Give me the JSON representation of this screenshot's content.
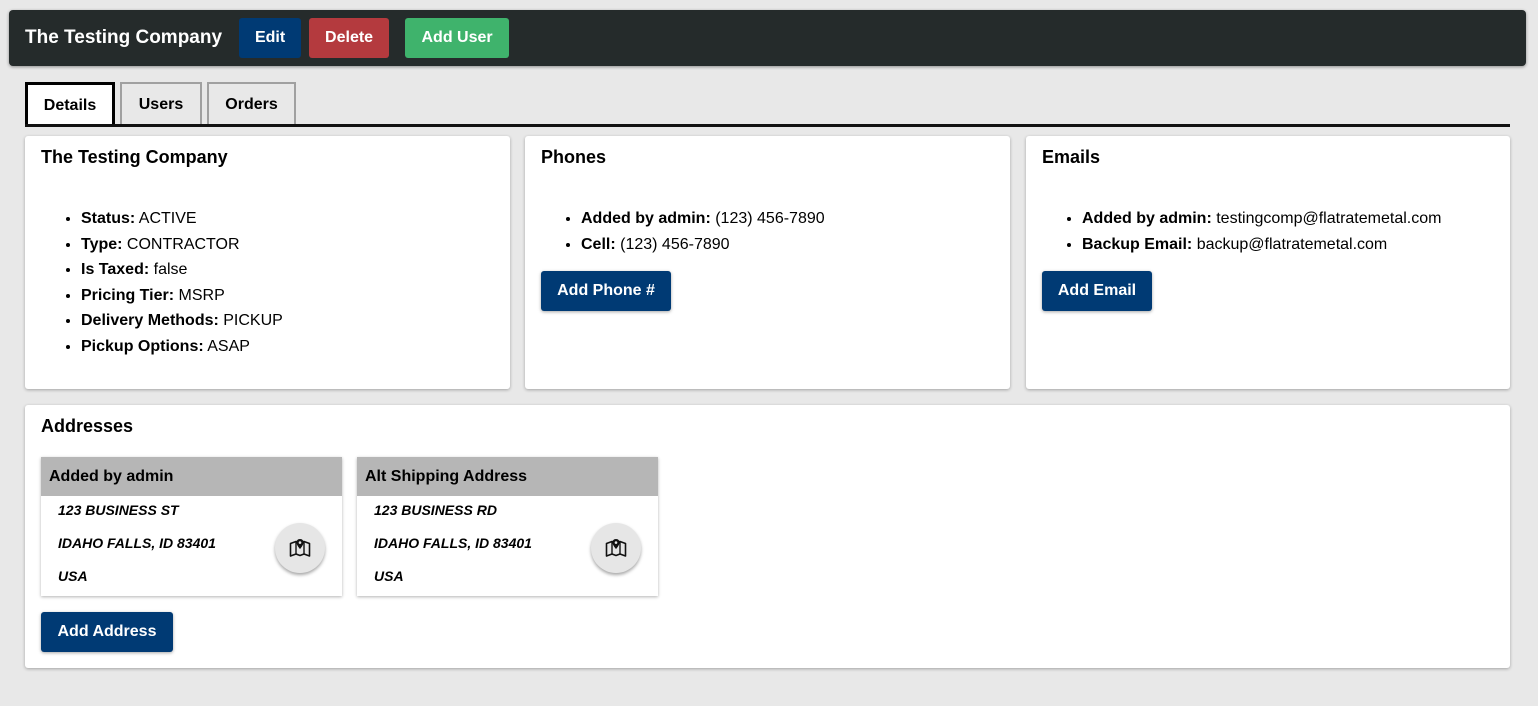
{
  "header": {
    "title": "The Testing Company",
    "edit_label": "Edit",
    "delete_label": "Delete",
    "add_user_label": "Add User"
  },
  "tabs": [
    {
      "label": "Details",
      "active": true
    },
    {
      "label": "Users",
      "active": false
    },
    {
      "label": "Orders",
      "active": false
    }
  ],
  "details": {
    "title": "The Testing Company",
    "items": [
      {
        "label": "Status:",
        "value": " ACTIVE"
      },
      {
        "label": "Type:",
        "value": " CONTRACTOR"
      },
      {
        "label": "Is Taxed:",
        "value": " false"
      },
      {
        "label": "Pricing Tier:",
        "value": " MSRP"
      },
      {
        "label": "Delivery Methods:",
        "value": " PICKUP"
      },
      {
        "label": "Pickup Options:",
        "value": " ASAP"
      }
    ]
  },
  "phones": {
    "title": "Phones",
    "items": [
      {
        "label": "Added by admin:",
        "value": " (123) 456-7890"
      },
      {
        "label": "Cell:",
        "value": " (123) 456-7890"
      }
    ],
    "add_label": "Add Phone #"
  },
  "emails": {
    "title": "Emails",
    "items": [
      {
        "label": "Added by admin:",
        "value": " testingcomp@flatratemetal.com"
      },
      {
        "label": "Backup Email:",
        "value": " backup@flatratemetal.com"
      }
    ],
    "add_label": "Add Email"
  },
  "addresses": {
    "title": "Addresses",
    "items": [
      {
        "name": "Added by admin",
        "line1": "123 BUSINESS ST",
        "line2": "IDAHO FALLS, ID 83401",
        "line3": "USA",
        "icon": "map-pin-icon"
      },
      {
        "name": "Alt Shipping Address",
        "line1": "123 BUSINESS RD",
        "line2": "IDAHO FALLS, ID 83401",
        "line3": "USA",
        "icon": "map-pin-icon"
      }
    ],
    "add_label": "Add Address"
  },
  "colors": {
    "topbar": "#252b2b",
    "primary": "#003a74",
    "danger": "#b43a3e",
    "success": "#3fb36c",
    "address_header": "#b6b6b6"
  }
}
